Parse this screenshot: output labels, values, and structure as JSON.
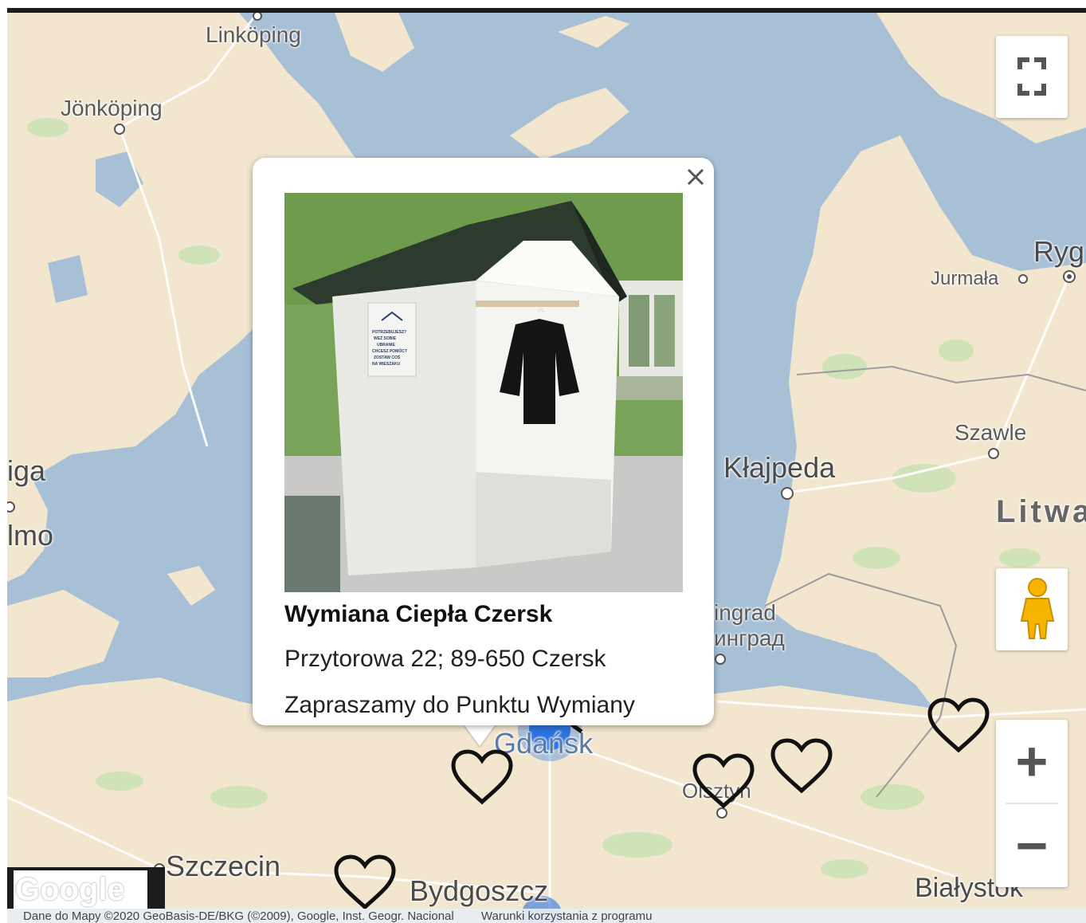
{
  "map": {
    "places": [
      {
        "id": "linkoping",
        "name": "Linköping"
      },
      {
        "id": "jonkoping",
        "name": "Jönköping"
      },
      {
        "id": "jurmala",
        "name": "Jurmała"
      },
      {
        "id": "ryga",
        "name": "Ryg"
      },
      {
        "id": "szawle",
        "name": "Szawle"
      },
      {
        "id": "klajpeda",
        "name": "Kłajpeda"
      },
      {
        "id": "litwa",
        "name": "Litwa"
      },
      {
        "id": "karlshamn",
        "name": "iga"
      },
      {
        "id": "malmo",
        "name": "lmo"
      },
      {
        "id": "kaliningrad-pl",
        "name": "ingrad"
      },
      {
        "id": "kaliningrad-ru",
        "name": "инград"
      },
      {
        "id": "gdansk",
        "name": "Gdańsk"
      },
      {
        "id": "olsztyn",
        "name": "Olsztyn"
      },
      {
        "id": "szczecin",
        "name": "Szczecin"
      },
      {
        "id": "bydgoszcz",
        "name": "Bydgoszcz"
      },
      {
        "id": "bialystok",
        "name": "Białystok"
      }
    ],
    "logo": "Google",
    "attribution": "Dane do Mapy ©2020 GeoBasis-DE/BKG (©2009), Google, Inst. Geogr. Nacional",
    "terms": "Warunki korzystania z programu"
  },
  "controls": {
    "fullscreen_icon": "fullscreen-icon",
    "pegman_icon": "pegman-icon",
    "zoom_in_label": "+",
    "zoom_out_label": "−"
  },
  "infowindow": {
    "title": "Wymiana Ciepła Czersk",
    "address": "Przytorowa 22; 89-650 Czersk",
    "description": "Zapraszamy do Punktu Wymiany",
    "close_label": "×",
    "photo_sign_lines": [
      "POTRZEBUJESZ?",
      "WEŹ SOBIE",
      "UBRANIE",
      "CHCESZ POMÓC?",
      "ZOSTAW COŚ",
      "NA WIESZAKU"
    ]
  },
  "markers": {
    "icon": "heart-outline-icon",
    "count": 6
  },
  "colors": {
    "water": "#a8c0d6",
    "land": "#f2e6cf",
    "forest": "#cfe2b8",
    "popup": "#ffffff"
  }
}
